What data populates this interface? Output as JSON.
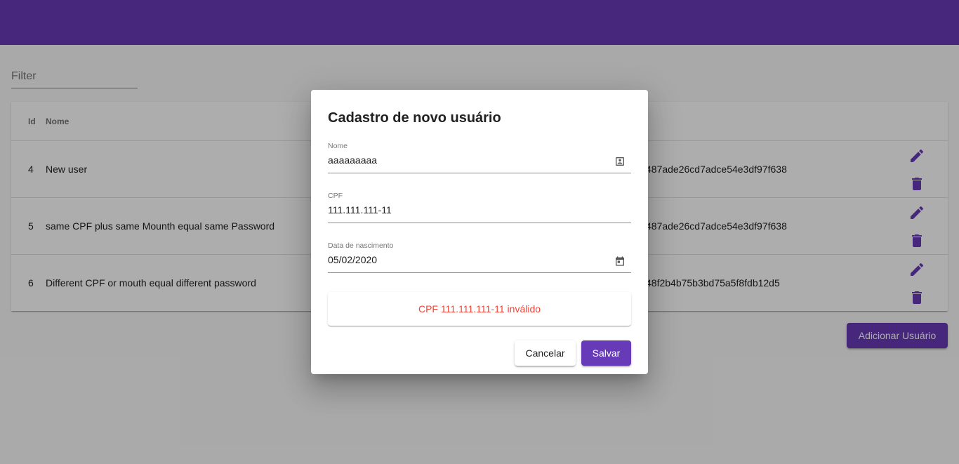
{
  "theme": {
    "primary": "#673ab7",
    "error": "#f44336",
    "backdrop": "rgba(0,0,0,0.32)"
  },
  "filter": {
    "label": "Filter"
  },
  "table": {
    "headers": {
      "id": "Id",
      "name": "Nome"
    },
    "rows": [
      {
        "id": "4",
        "name": "New user",
        "hash": "487ade26cd7adce54e3df97f638"
      },
      {
        "id": "5",
        "name": "same CPF plus same Mounth equal same Password",
        "hash": "487ade26cd7adce54e3df97f638"
      },
      {
        "id": "6",
        "name": "Different CPF or mouth equal different password",
        "hash": "48f2b4b75b3bd75a5f8fdb12d5"
      }
    ],
    "icons": {
      "edit": "edit-icon",
      "delete": "delete-icon"
    }
  },
  "add_button": {
    "label": "Adicionar Usuário"
  },
  "dialog": {
    "title": "Cadastro de novo usuário",
    "fields": {
      "nome": {
        "label": "Nome",
        "value": "aaaaaaaaa",
        "icon": "contact-card-icon"
      },
      "cpf": {
        "label": "CPF",
        "value": "111.111.111-11"
      },
      "nascimento": {
        "label": "Data de nascimento",
        "value": "05/02/2020",
        "icon": "calendar-icon"
      }
    },
    "error": "CPF 111.111.111-11 inválido",
    "cancel_label": "Cancelar",
    "save_label": "Salvar"
  }
}
